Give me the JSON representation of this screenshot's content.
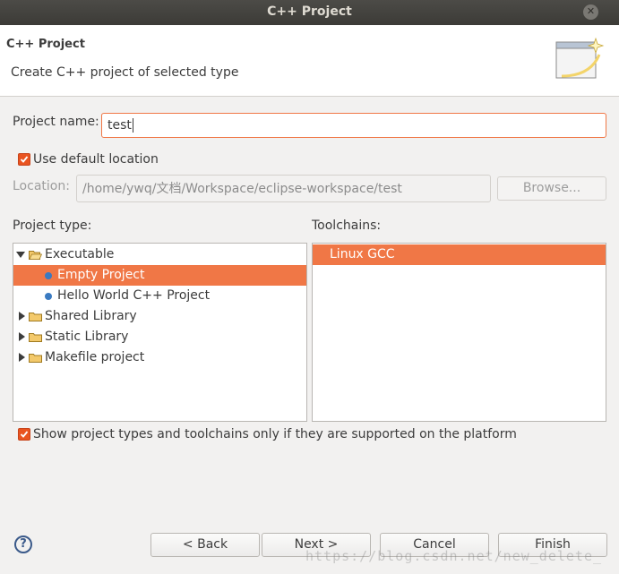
{
  "window": {
    "title": "C++ Project"
  },
  "header": {
    "title": "C++ Project",
    "description": "Create C++ project of selected type"
  },
  "project_name": {
    "label": "Project name:",
    "value": "test"
  },
  "default_location": {
    "label": "Use default location",
    "checked": true
  },
  "location": {
    "label": "Location:",
    "value": "/home/ywq/文档/Workspace/eclipse-workspace/test",
    "browse_label": "Browse..."
  },
  "project_type": {
    "label": "Project type:",
    "items": [
      {
        "label": "Executable",
        "kind": "folder",
        "expanded": true,
        "level": 0
      },
      {
        "label": "Empty Project",
        "kind": "leaf",
        "level": 1,
        "selected": true
      },
      {
        "label": "Hello World C++ Project",
        "kind": "leaf",
        "level": 1
      },
      {
        "label": "Shared Library",
        "kind": "folder",
        "expanded": false,
        "level": 0
      },
      {
        "label": "Static Library",
        "kind": "folder",
        "expanded": false,
        "level": 0
      },
      {
        "label": "Makefile project",
        "kind": "folder",
        "expanded": false,
        "level": 0
      }
    ]
  },
  "toolchains": {
    "label": "Toolchains:",
    "items": [
      {
        "label": "Linux GCC",
        "selected": true
      }
    ]
  },
  "supported_only": {
    "label": "Show project types and toolchains only if they are supported on the platform",
    "checked": true
  },
  "buttons": {
    "help": "?",
    "back": "< Back",
    "next": "Next >",
    "cancel": "Cancel",
    "finish": "Finish"
  },
  "watermark": "https://blog.csdn.net/new_delete_",
  "colors": {
    "accent": "#e95420",
    "selection": "#f07746"
  }
}
